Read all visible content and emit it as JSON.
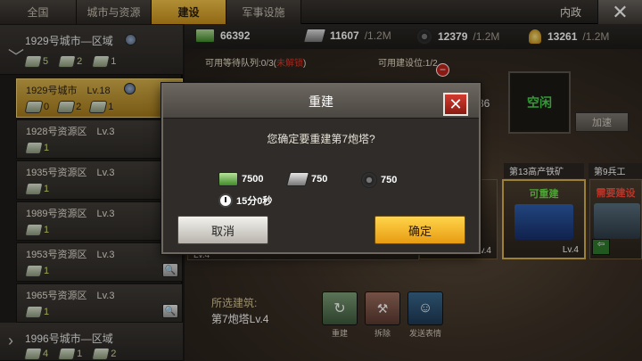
{
  "tabs": [
    {
      "label": "全国"
    },
    {
      "label": "城市与资源"
    },
    {
      "label": "建设",
      "active": true
    },
    {
      "label": "军事设施"
    }
  ],
  "header": {
    "section_label": "内政",
    "close_symbol": "✕"
  },
  "resources": {
    "money": {
      "value": "66392"
    },
    "steel": {
      "value": "11607",
      "capacity": "/1.2M"
    },
    "rubber": {
      "value": "12379",
      "capacity": "/1.2M"
    },
    "gold": {
      "value": "13261",
      "capacity": "/1.2M"
    }
  },
  "sidebar": {
    "region_top": {
      "title": "1929号城市—区域",
      "stats": [
        "5",
        "2",
        "1"
      ],
      "chevron": "﹀"
    },
    "rows": [
      {
        "title": "1929号城市　Lv.18",
        "stats": [
          "0",
          "2",
          "1"
        ],
        "selected": true
      },
      {
        "title": "1928号资源区　Lv.3",
        "stats": [
          "1"
        ]
      },
      {
        "title": "1935号资源区　Lv.3",
        "stats": [
          "1"
        ]
      },
      {
        "title": "1989号资源区　Lv.3",
        "stats": [
          "1"
        ]
      },
      {
        "title": "1953号资源区　Lv.3",
        "stats": [
          "1"
        ],
        "search": true
      },
      {
        "title": "1965号资源区　Lv.3",
        "stats": [
          "1"
        ],
        "search": true
      }
    ],
    "region_bottom": {
      "title": "1996号城市—区域",
      "stats": [
        "4",
        "1",
        "2"
      ],
      "chevron": "›"
    }
  },
  "queue": {
    "text_prefix": "可用等待队列:0/3(",
    "status": "未解锁",
    "text_suffix": ")",
    "slots": "可用建设位:1/2"
  },
  "partial_text": "36",
  "idle_box": {
    "label": "空闲"
  },
  "speed_button": {
    "label": "加速"
  },
  "cards": [
    {
      "label": "第13高产铁矿",
      "tag": "可重建",
      "level": "Lv.4"
    },
    {
      "label": "第9兵工",
      "tag": "需要建设",
      "level": ""
    }
  ],
  "bottom_panel": {
    "selected_label": "所选建筑:",
    "selected_value": "第7炮塔Lv.4",
    "actions": [
      {
        "label": "重建"
      },
      {
        "label": "拆除"
      },
      {
        "label": "发送表情"
      }
    ],
    "card_levels": [
      "Lv.4",
      "Lv.4"
    ]
  },
  "dialog": {
    "title": "重建",
    "message": "您确定要重建第7炮塔?",
    "costs": {
      "money": "7500",
      "steel": "750",
      "rubber": "750"
    },
    "time": "15分0秒",
    "cancel_label": "取消",
    "confirm_label": "确定"
  },
  "colors": {
    "accent_gold": "#e7b22a",
    "confirm_button": "#f5b526",
    "close_red": "#c4291f",
    "idle_green": "#47d64a",
    "warning_red": "#e03a2a"
  }
}
